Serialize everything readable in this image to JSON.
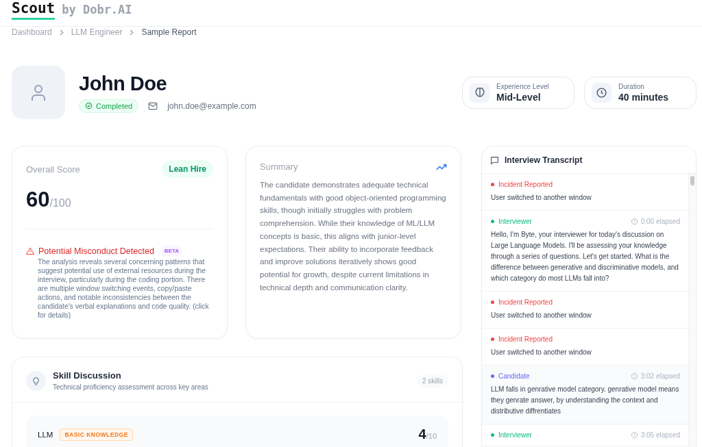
{
  "header": {
    "logo": "Scout",
    "byline": "by Dobr.AI"
  },
  "breadcrumb": [
    "Dashboard",
    "LLM Engineer",
    "Sample Report"
  ],
  "candidate": {
    "name": "John Doe",
    "status": "Completed",
    "email": "john.doe@example.com"
  },
  "stats": [
    {
      "kind": "experience",
      "label": "Experience Level",
      "value": "Mid-Level"
    },
    {
      "kind": "duration",
      "label": "Duration",
      "value": "40 minutes"
    }
  ],
  "score_card": {
    "title": "Overall Score",
    "verdict": "Lean Hire",
    "score": "60",
    "max": "/100",
    "alert": {
      "title": "Potential Misconduct Detected",
      "badge": "BETA",
      "text": "The analysis reveals several concerning patterns that suggest potential use of external resources during the interview, particularly during the coding portion. There are multiple window switching events, copy/paste actions, and notable inconsistencies between the candidate's verbal explanations and code quality. (click for details)"
    }
  },
  "summary": {
    "title": "Summary",
    "text": "The candidate demonstrates adequate technical fundamentals with good object-oriented programming skills, though initially struggles with problem comprehension. While their knowledge of ML/LLM concepts is basic, this aligns with junior-level expectations. Their ability to incorporate feedback and improve solutions iteratively shows good potential for growth, despite current limitations in technical depth and communication clarity."
  },
  "skills": {
    "title": "Skill Discussion",
    "subtitle": "Technical proficiency assessment across key areas",
    "count": "2 skills",
    "items": [
      {
        "name": "LLM",
        "level_label": "BASIC KNOWLEDGE",
        "score": "4",
        "max": "/10"
      }
    ]
  },
  "transcript": {
    "title": "Interview Transcript",
    "entries": [
      {
        "kind": "incident",
        "speaker": "Incident Reported",
        "text": "User switched to another window"
      },
      {
        "kind": "interviewer",
        "speaker": "Interviewer",
        "time": "0:00 elapsed",
        "text": "Hello, I'm Byte, your interviewer for today's discussion on Large Language Models. I'll be assessing your knowledge through a series of questions. Let's get started. What is the difference between generative and discriminative models, and which category do most LLMs fall into?"
      },
      {
        "kind": "incident",
        "speaker": "Incident Reported",
        "text": "User switched to another window"
      },
      {
        "kind": "incident",
        "speaker": "Incident Reported",
        "text": "User switched to another window"
      },
      {
        "kind": "candidate",
        "speaker": "Candidate",
        "time": "3:02 elapsed",
        "text": "LLM falls in genrative model category. genrative model means they genrate answer, by understanding  the context and distributive diffrentiates"
      },
      {
        "kind": "interviewer",
        "speaker": "Interviewer",
        "time": "3:05 elapsed"
      }
    ]
  }
}
